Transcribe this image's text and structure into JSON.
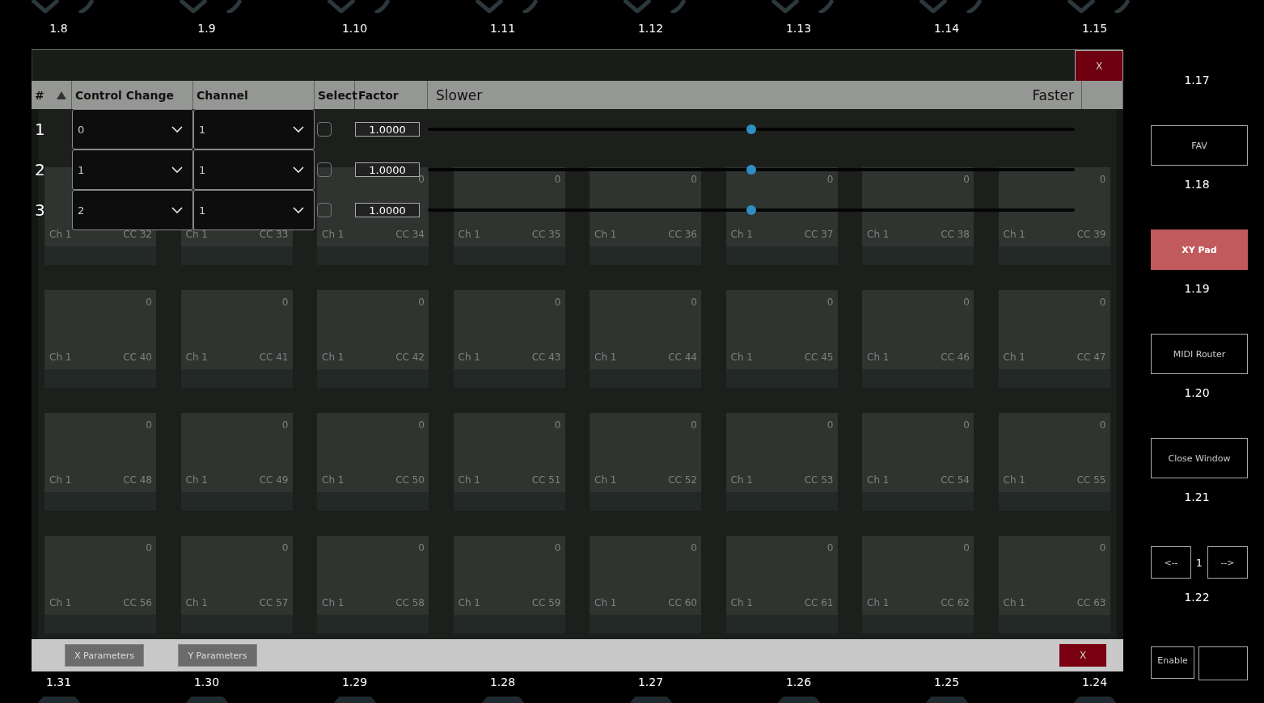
{
  "top_labels": [
    "1.8",
    "1.9",
    "1.10",
    "1.11",
    "1.12",
    "1.13",
    "1.14",
    "1.15"
  ],
  "modal": {
    "close": "X",
    "table": {
      "columns": [
        {
          "label": "#",
          "sorted": true
        },
        {
          "label": "Control Change",
          "sorted": false
        },
        {
          "label": "Channel",
          "sorted": false
        },
        {
          "label": "Select",
          "sorted": false
        },
        {
          "label": "Factor",
          "sorted": false
        }
      ],
      "slider_labels": [
        "Slower",
        "Faster"
      ],
      "rows": [
        {
          "number": "1",
          "control_change": "0",
          "channel": "1",
          "checked": false,
          "factor": "1.0000",
          "level": 0.5
        },
        {
          "number": "2",
          "control_change": "1",
          "channel": "1",
          "checked": false,
          "factor": "1.0000",
          "level": 0.5
        },
        {
          "number": "3",
          "control_change": "2",
          "channel": "1",
          "checked": false,
          "factor": "1.0000",
          "level": 0.5
        }
      ]
    },
    "pads": [
      {
        "channel": "Ch 1",
        "cc": "CC 32"
      },
      {
        "channel": "Ch 1",
        "cc": "CC 33"
      },
      {
        "value": "0",
        "channel": "Ch 1",
        "cc": "CC 34"
      },
      {
        "value": "0",
        "channel": "Ch 1",
        "cc": "CC 35"
      },
      {
        "value": "0",
        "channel": "Ch 1",
        "cc": "CC 36"
      },
      {
        "value": "0",
        "channel": "Ch 1",
        "cc": "CC 37"
      },
      {
        "value": "0",
        "channel": "Ch 1",
        "cc": "CC 38"
      },
      {
        "value": "0",
        "channel": "Ch 1",
        "cc": "CC 39"
      },
      {
        "value": "0",
        "channel": "Ch 1",
        "cc": "CC 40"
      },
      {
        "value": "0",
        "channel": "Ch 1",
        "cc": "CC 41"
      },
      {
        "value": "0",
        "channel": "Ch 1",
        "cc": "CC 42"
      },
      {
        "value": "0",
        "channel": "Ch 1",
        "cc": "CC 43"
      },
      {
        "value": "0",
        "channel": "Ch 1",
        "cc": "CC 44"
      },
      {
        "value": "0",
        "channel": "Ch 1",
        "cc": "CC 45"
      },
      {
        "value": "0",
        "channel": "Ch 1",
        "cc": "CC 46"
      },
      {
        "value": "0",
        "channel": "Ch 1",
        "cc": "CC 47"
      },
      {
        "value": "0",
        "channel": "Ch 1",
        "cc": "CC 48"
      },
      {
        "value": "0",
        "channel": "Ch 1",
        "cc": "CC 49"
      },
      {
        "value": "0",
        "channel": "Ch 1",
        "cc": "CC 50"
      },
      {
        "value": "0",
        "channel": "Ch 1",
        "cc": "CC 51"
      },
      {
        "value": "0",
        "channel": "Ch 1",
        "cc": "CC 52"
      },
      {
        "value": "0",
        "channel": "Ch 1",
        "cc": "CC 53"
      },
      {
        "value": "0",
        "channel": "Ch 1",
        "cc": "CC 54"
      },
      {
        "value": "0",
        "channel": "Ch 1",
        "cc": "CC 55"
      },
      {
        "value": "0",
        "channel": "Ch 1",
        "cc": "CC 56"
      },
      {
        "value": "0",
        "channel": "Ch 1",
        "cc": "CC 57"
      },
      {
        "value": "0",
        "channel": "Ch 1",
        "cc": "CC 58"
      },
      {
        "value": "0",
        "channel": "Ch 1",
        "cc": "CC 59"
      },
      {
        "value": "0",
        "channel": "Ch 1",
        "cc": "CC 60"
      },
      {
        "value": "0",
        "channel": "Ch 1",
        "cc": "CC 61"
      },
      {
        "value": "0",
        "channel": "Ch 1",
        "cc": "CC 62"
      },
      {
        "value": "0",
        "channel": "Ch 1",
        "cc": "CC 63"
      }
    ],
    "footer": {
      "buttons": [
        "X Parameters",
        "Y Parameters"
      ],
      "close": "X"
    }
  },
  "bottom_labels": [
    "1.31",
    "1.30",
    "1.29",
    "1.28",
    "1.27",
    "1.26",
    "1.25",
    "1.24"
  ],
  "sidebar": [
    {
      "kind": "label",
      "text": "1.17"
    },
    {
      "kind": "button",
      "text": "FAV",
      "selected": false
    },
    {
      "kind": "label",
      "text": "1.18"
    },
    {
      "kind": "button",
      "text": "XY Pad",
      "selected": true
    },
    {
      "kind": "label",
      "text": "1.19"
    },
    {
      "kind": "button",
      "text": "MIDI Router",
      "selected": false
    },
    {
      "kind": "label",
      "text": "1.20"
    },
    {
      "kind": "button",
      "text": "Close Window",
      "selected": false
    },
    {
      "kind": "label",
      "text": "1.21"
    },
    {
      "kind": "pager",
      "prev": "<--",
      "page": "1",
      "next": "-->"
    },
    {
      "kind": "label",
      "text": "1.22"
    },
    {
      "kind": "pair",
      "first": "Enable"
    }
  ]
}
